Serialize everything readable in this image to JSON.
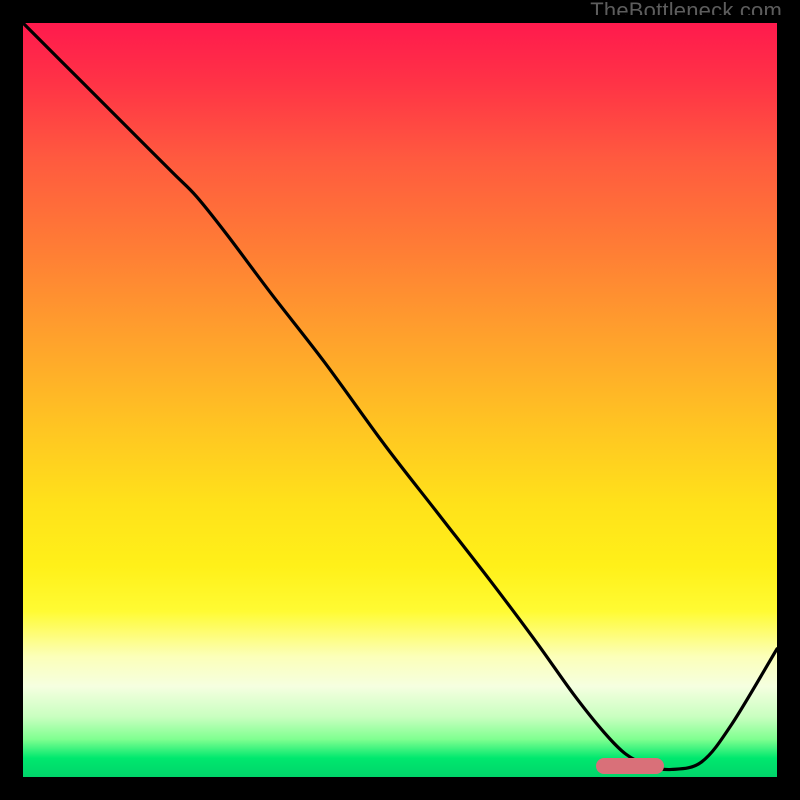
{
  "watermark": "TheBottleneck.com",
  "colors": {
    "frame": "#000000",
    "curve": "#000000",
    "marker": "#d97079"
  },
  "chart_data": {
    "type": "line",
    "title": "",
    "xlabel": "",
    "ylabel": "",
    "xlim": [
      0,
      100
    ],
    "ylim": [
      0,
      100
    ],
    "x": [
      0,
      5,
      10,
      15,
      20,
      23,
      27,
      33,
      40,
      48,
      55,
      62,
      68,
      73,
      77,
      80,
      83,
      86,
      90,
      94,
      100
    ],
    "values": [
      100,
      95,
      90,
      85,
      80,
      77,
      72,
      64,
      55,
      44,
      35,
      26,
      18,
      11,
      6,
      3,
      1.5,
      1,
      2,
      7,
      17
    ],
    "marker_x_range": [
      76,
      85
    ],
    "marker_y": 1.5,
    "gradient_stops": [
      {
        "pos": 0,
        "color": "#ff1a4d"
      },
      {
        "pos": 50,
        "color": "#ffc020"
      },
      {
        "pos": 78,
        "color": "#fffb33"
      },
      {
        "pos": 100,
        "color": "#00d46a"
      }
    ]
  }
}
